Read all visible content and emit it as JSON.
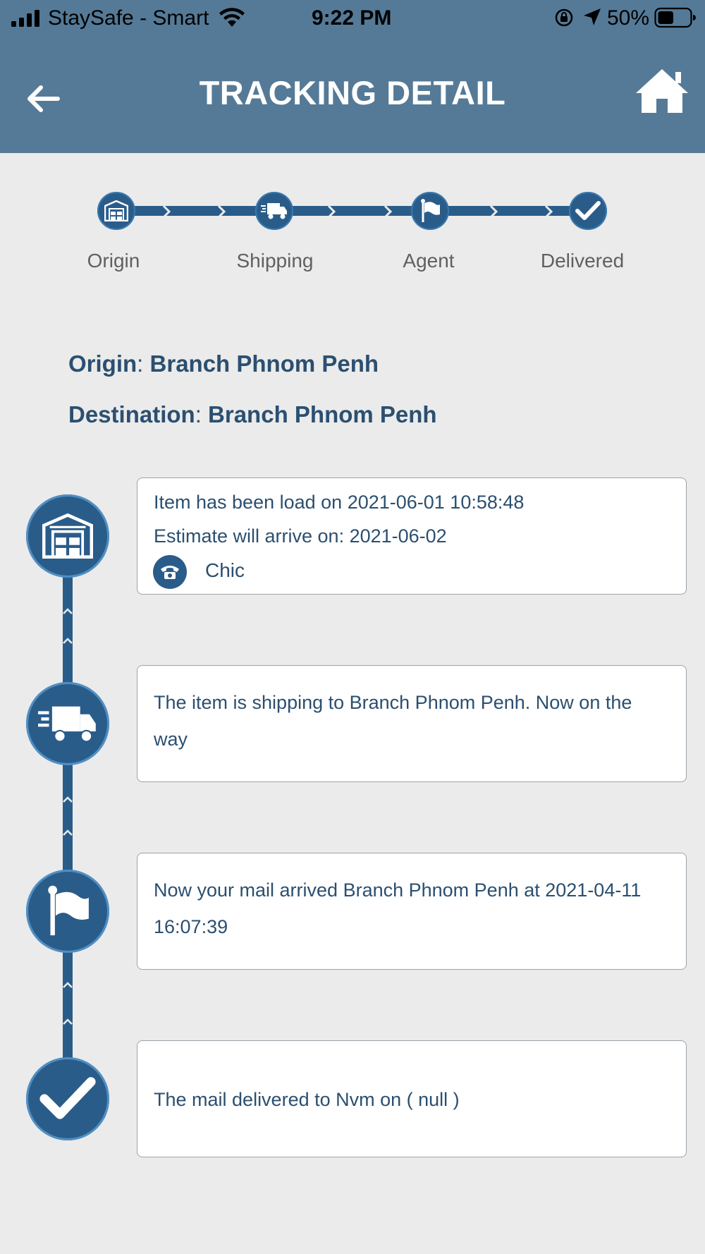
{
  "status_bar": {
    "carrier": "StaySafe - Smart",
    "time": "9:22 PM",
    "battery_percent": "50%",
    "battery_level": 0.5
  },
  "header": {
    "title": "TRACKING DETAIL",
    "back_icon": "arrow-left-icon",
    "home_icon": "home-icon"
  },
  "stepper": {
    "steps": [
      {
        "label": "Origin",
        "icon": "warehouse-icon"
      },
      {
        "label": "Shipping",
        "icon": "truck-icon"
      },
      {
        "label": "Agent",
        "icon": "flag-icon"
      },
      {
        "label": "Delivered",
        "icon": "check-icon"
      }
    ]
  },
  "info": {
    "origin_label": "Origin",
    "origin_value": "Branch Phnom Penh",
    "destination_label": "Destination",
    "destination_value": "Branch Phnom Penh",
    "separator": ":"
  },
  "timeline": {
    "events": [
      {
        "icon": "warehouse-icon",
        "line1": "Item has been load on 2021-06-01 10:58:48",
        "line2": "Estimate will arrive on: 2021-06-02",
        "contact_icon": "phone-icon",
        "contact": "Chic"
      },
      {
        "icon": "truck-icon",
        "text": "The item is shipping to Branch Phnom Penh. Now on the way"
      },
      {
        "icon": "flag-icon",
        "text": "Now your mail arrived Branch Phnom Penh at 2021-04-11 16:07:39"
      },
      {
        "icon": "check-icon",
        "text": "The mail delivered to  Nvm on ( null )"
      }
    ]
  },
  "colors": {
    "header_bg": "#557a97",
    "accent": "#2a5c8a",
    "text_primary": "#2b4f70",
    "page_bg": "#ebebeb"
  }
}
